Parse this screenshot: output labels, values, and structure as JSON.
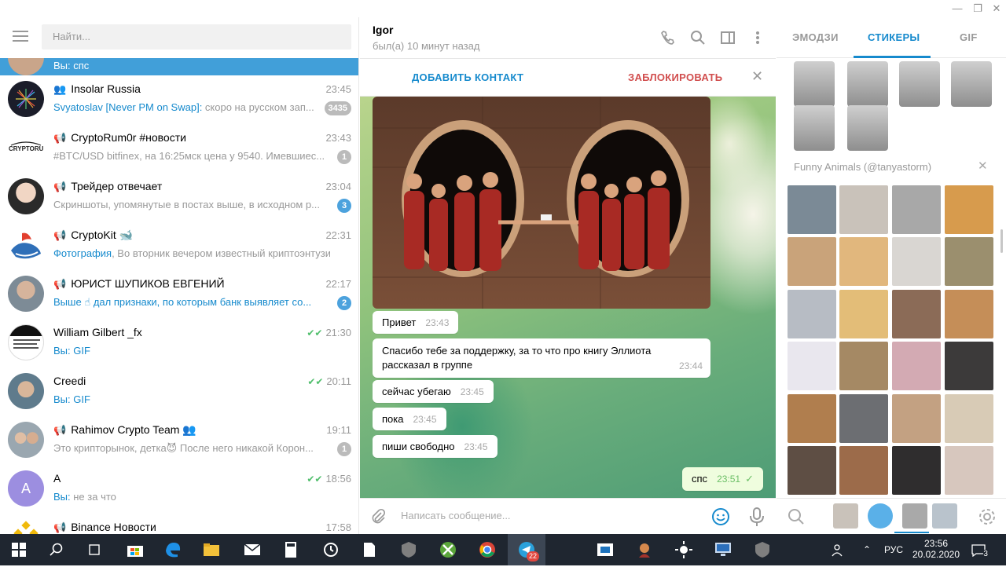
{
  "left": {
    "search_placeholder": "Найти...",
    "active_preview": "Вы: спс",
    "chats": [
      {
        "name": "Insolar Russia",
        "kind": "group",
        "time": "23:45",
        "sender": "Svyatoslav [Never PM on Swap]:",
        "preview": " скоро на русском зап...",
        "badge": "3435",
        "badge_color": "grey"
      },
      {
        "name": "CryptoRum0r #новости",
        "kind": "channel",
        "time": "23:43",
        "sender": "",
        "preview": "#BTC/USD bitfinex, на 16:25мск цена у 9540. Имевшиес...",
        "badge": "1",
        "badge_color": "grey"
      },
      {
        "name": "Трейдер отвечает",
        "kind": "channel",
        "time": "23:04",
        "sender": "",
        "preview": "Скриншоты, упомянутые в постах выше, в исходном р...",
        "badge": "3",
        "badge_color": "blue"
      },
      {
        "name": "CryptoKit 🐋",
        "kind": "channel",
        "time": "22:31",
        "sender": "Фотография",
        "preview": ", Во вторник вечером известный криптоэнтузи...",
        "badge": "",
        "badge_color": ""
      },
      {
        "name": "ЮРИСТ ШУПИКОВ ЕВГЕНИЙ",
        "kind": "channel",
        "time": "22:17",
        "sender": "Выше ☝ дал признаки, по которым банк выявляет со...",
        "preview": "",
        "badge": "2",
        "badge_color": "blue"
      },
      {
        "name": "William Gilbert _fx",
        "kind": "user",
        "time": "21:30",
        "sender": "Вы: GIF",
        "preview": "",
        "badge": "",
        "badge_color": "",
        "read": true
      },
      {
        "name": "Creedi",
        "kind": "user",
        "time": "20:11",
        "sender": "Вы: GIF",
        "preview": "",
        "badge": "",
        "badge_color": "",
        "read": true
      },
      {
        "name": "Rahimov Crypto Team 👥",
        "kind": "channel",
        "time": "19:11",
        "sender": "",
        "preview": "Это крипторынок, детка😈 После него никакой Корон...",
        "badge": "1",
        "badge_color": "grey"
      },
      {
        "name": "A",
        "kind": "user",
        "time": "18:56",
        "sender": "Вы:",
        "preview": " не за что",
        "badge": "",
        "badge_color": "",
        "read": true
      },
      {
        "name": "Binance Новости",
        "kind": "channel",
        "time": "17:58",
        "sender": "",
        "preview": "",
        "badge": "",
        "badge_color": ""
      }
    ]
  },
  "chat": {
    "peer_name": "Igor",
    "peer_status": "был(а) 10 минут назад",
    "add_contact": "ДОБАВИТЬ КОНТАКТ",
    "block": "ЗАБЛОКИРОВАТЬ",
    "messages": [
      {
        "text": "Привет",
        "time": "23:43",
        "out": false
      },
      {
        "text": "Спасибо тебе за поддержку, за то что про книгу Эллиота рассказал в группе",
        "time": "23:44",
        "out": false
      },
      {
        "text": "сейчас убегаю",
        "time": "23:45",
        "out": false
      },
      {
        "text": "пока",
        "time": "23:45",
        "out": false
      },
      {
        "text": "пиши свободно",
        "time": "23:45",
        "out": false
      },
      {
        "text": "спс",
        "time": "23:51",
        "out": true
      }
    ],
    "input_placeholder": "Написать сообщение..."
  },
  "panel": {
    "tabs": [
      "ЭМОДЗИ",
      "СТИКЕРЫ",
      "GIF"
    ],
    "active_tab": "СТИКЕРЫ",
    "pack_title": "Funny Animals (@tanyastorm)"
  },
  "taskbar": {
    "lang": "РУС",
    "time": "23:56",
    "date": "20.02.2020",
    "telegram_badge": "22",
    "notif_count": "3"
  },
  "colors": {
    "accent": "#168acd",
    "active_row": "#419fd9",
    "block_red": "#d14e4e",
    "out_bubble": "#effdde",
    "taskbar": "#1f2630"
  }
}
